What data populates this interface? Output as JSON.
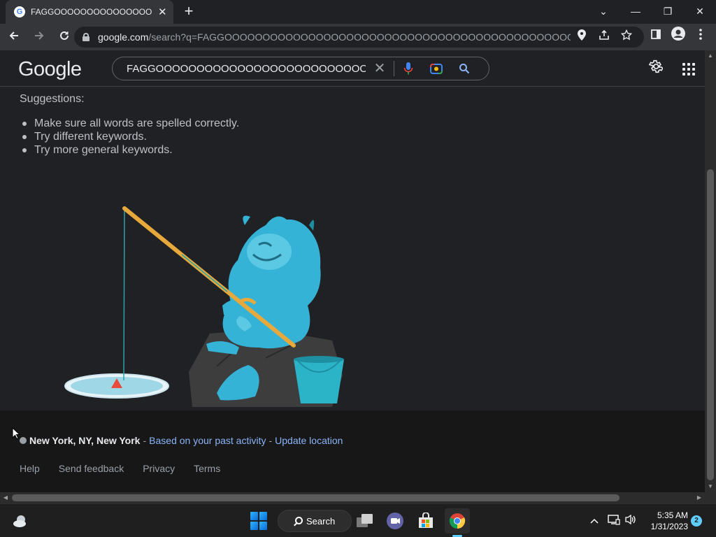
{
  "browser": {
    "tab_title": "FAGGOOOOOOOOOOOOOOOOOOOOOOOOOOOOOOOOOOOOOOOOOOO",
    "tab_close": "✕",
    "new_tab": "+",
    "url_host": "google.com",
    "url_path": "/search?q=FAGGOOOOOOOOOOOOOOOOOOOOOOOOOOOOOOOOOOOOOOOOOOOOOOO...",
    "window_controls": {
      "dropdown": "⌄",
      "minimize": "—",
      "restore": "❐",
      "close": "✕"
    }
  },
  "google": {
    "logo": "Google",
    "query": "FAGGOOOOOOOOOOOOOOOOOOOOOOOOOOOOOOOOOOOOOOOO",
    "clear": "✕"
  },
  "suggestions": {
    "heading": "Suggestions:",
    "items": [
      "Make sure all words are spelled correctly.",
      "Try different keywords.",
      "Try more general keywords."
    ]
  },
  "footer": {
    "location": "New York, NY, New York",
    "separator": "-",
    "based_on": "Based on your past activity",
    "update_location": "Update location",
    "links": [
      "Help",
      "Send feedback",
      "Privacy",
      "Terms"
    ]
  },
  "taskbar": {
    "search_label": "Search",
    "time": "5:35 AM",
    "date": "1/31/2023",
    "notification_count": "2"
  },
  "colors": {
    "background": "#202124",
    "link": "#8ab4f8",
    "text": "#bdc1c6",
    "accent": "#60cdff"
  }
}
